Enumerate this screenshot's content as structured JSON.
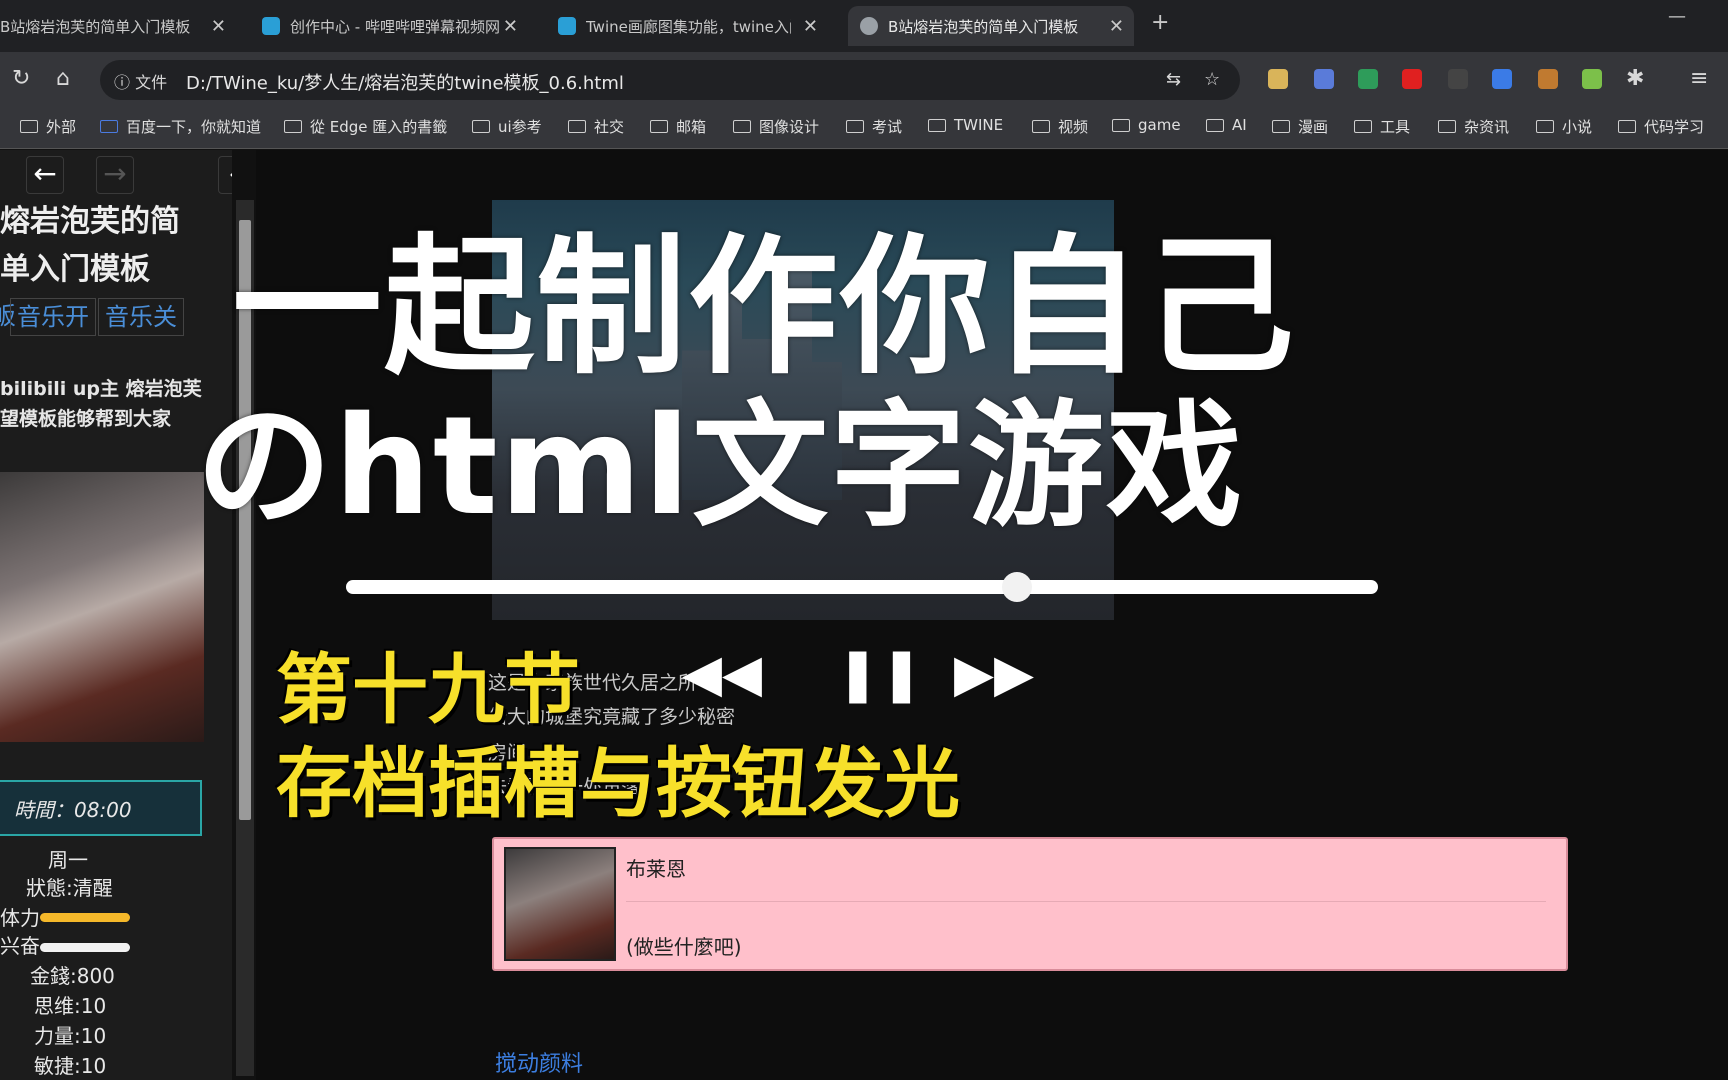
{
  "browser": {
    "tabs": [
      {
        "title": "B站熔岩泡芙的简单入门模板",
        "active": false
      },
      {
        "title": "创作中心 - 哔哩哔哩弹幕视频网",
        "active": false
      },
      {
        "title": "Twine画廊图集功能，twine入门",
        "active": false
      },
      {
        "title": "B站熔岩泡芙的简单入门模板",
        "active": true
      }
    ],
    "new_tab": "+",
    "close": "✕",
    "minimize": "—",
    "address": {
      "security_label": "文件",
      "url": "D:/TWine_ku/梦人生/熔岩泡芙的twine模板_0.6.html"
    },
    "bookmarks": [
      "外部",
      "百度一下，你就知道",
      "從 Edge 匯入的書籤",
      "ui参考",
      "社交",
      "邮箱",
      "图像设计",
      "考试",
      "TWINE",
      "视频",
      "game",
      "AI",
      "漫画",
      "工具",
      "杂资讯",
      "小说",
      "代码学习"
    ]
  },
  "sidebar": {
    "title_line1": "熔岩泡芙的简",
    "title_line2": "单入门模板",
    "music_prefix": "皈",
    "music_on": "音乐开",
    "music_off": "音乐关",
    "desc_line1": "bilibili up主 熔岩泡芙",
    "desc_line2": "望模板能够帮到大家",
    "time": "時間：08:00",
    "day": "周一",
    "status": "狀態:清醒",
    "stamina_label": "体力",
    "stamina_level": 0.75,
    "excite_label": "兴奋",
    "excite_level": 0.75,
    "money": "金錢:800",
    "thinking": "思维:10",
    "strength": "力量:10",
    "agility": "敏捷:10"
  },
  "overlay": {
    "title_line1": "一起制作你自己",
    "title_line2": "のhtml文字游戏",
    "subtitle_line1": "第十九节",
    "subtitle_line2": "存档插槽与按钮发光"
  },
  "player": {
    "prev": "◀◀",
    "pause": "❚❚",
    "next": "▶▶",
    "progress": 0.65
  },
  "story": {
    "line1": "这是你家族世代久居之所",
    "line2": "偌大的城堡究竟藏了多少秘密",
    "line3": "房间",
    "line4": "去看看每一处角落"
  },
  "dialog": {
    "name": "布莱恩",
    "line": "(做些什麼吧)"
  },
  "footer": {
    "link": "搅动颜料"
  },
  "colors": {
    "accent_link": "#3c7ee0",
    "dialog_bg": "#ffc0cb",
    "stamina": "#f5b82a",
    "excite": "#f2f2f2",
    "time_border": "#2aa6a6",
    "overlay_yellow": "#f7e02a"
  }
}
